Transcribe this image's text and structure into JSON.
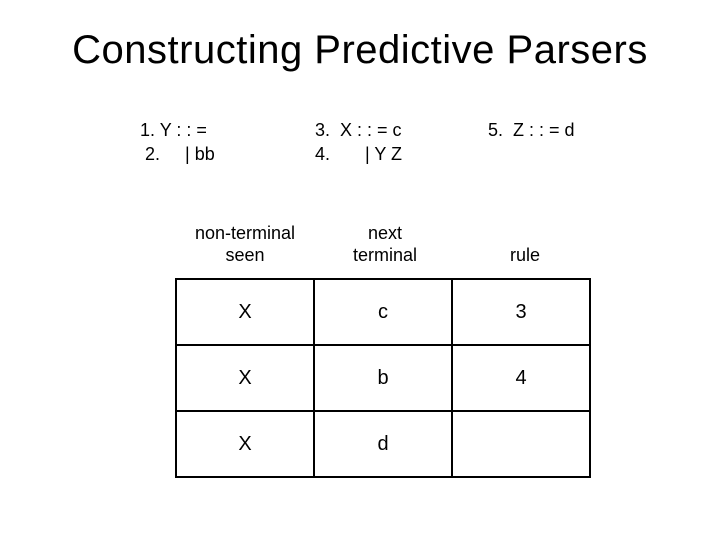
{
  "title": "Constructing Predictive Parsers",
  "grammar": {
    "col1": {
      "line1": "1. Y : : =",
      "line2": " 2.     | bb"
    },
    "col2": {
      "line1": "3.  X : : = c",
      "line2": "4.       | Y Z"
    },
    "col3": {
      "line1": "5.  Z : : = d"
    }
  },
  "headers": {
    "nonterminal_line1": "non-terminal",
    "nonterminal_line2": "seen",
    "next_line1": "next",
    "next_line2": "terminal",
    "rule": "rule"
  },
  "table": {
    "rows": [
      {
        "nt": "X",
        "term": "c",
        "rule": "3"
      },
      {
        "nt": "X",
        "term": "b",
        "rule": "4"
      },
      {
        "nt": "X",
        "term": "d",
        "rule": ""
      }
    ]
  }
}
